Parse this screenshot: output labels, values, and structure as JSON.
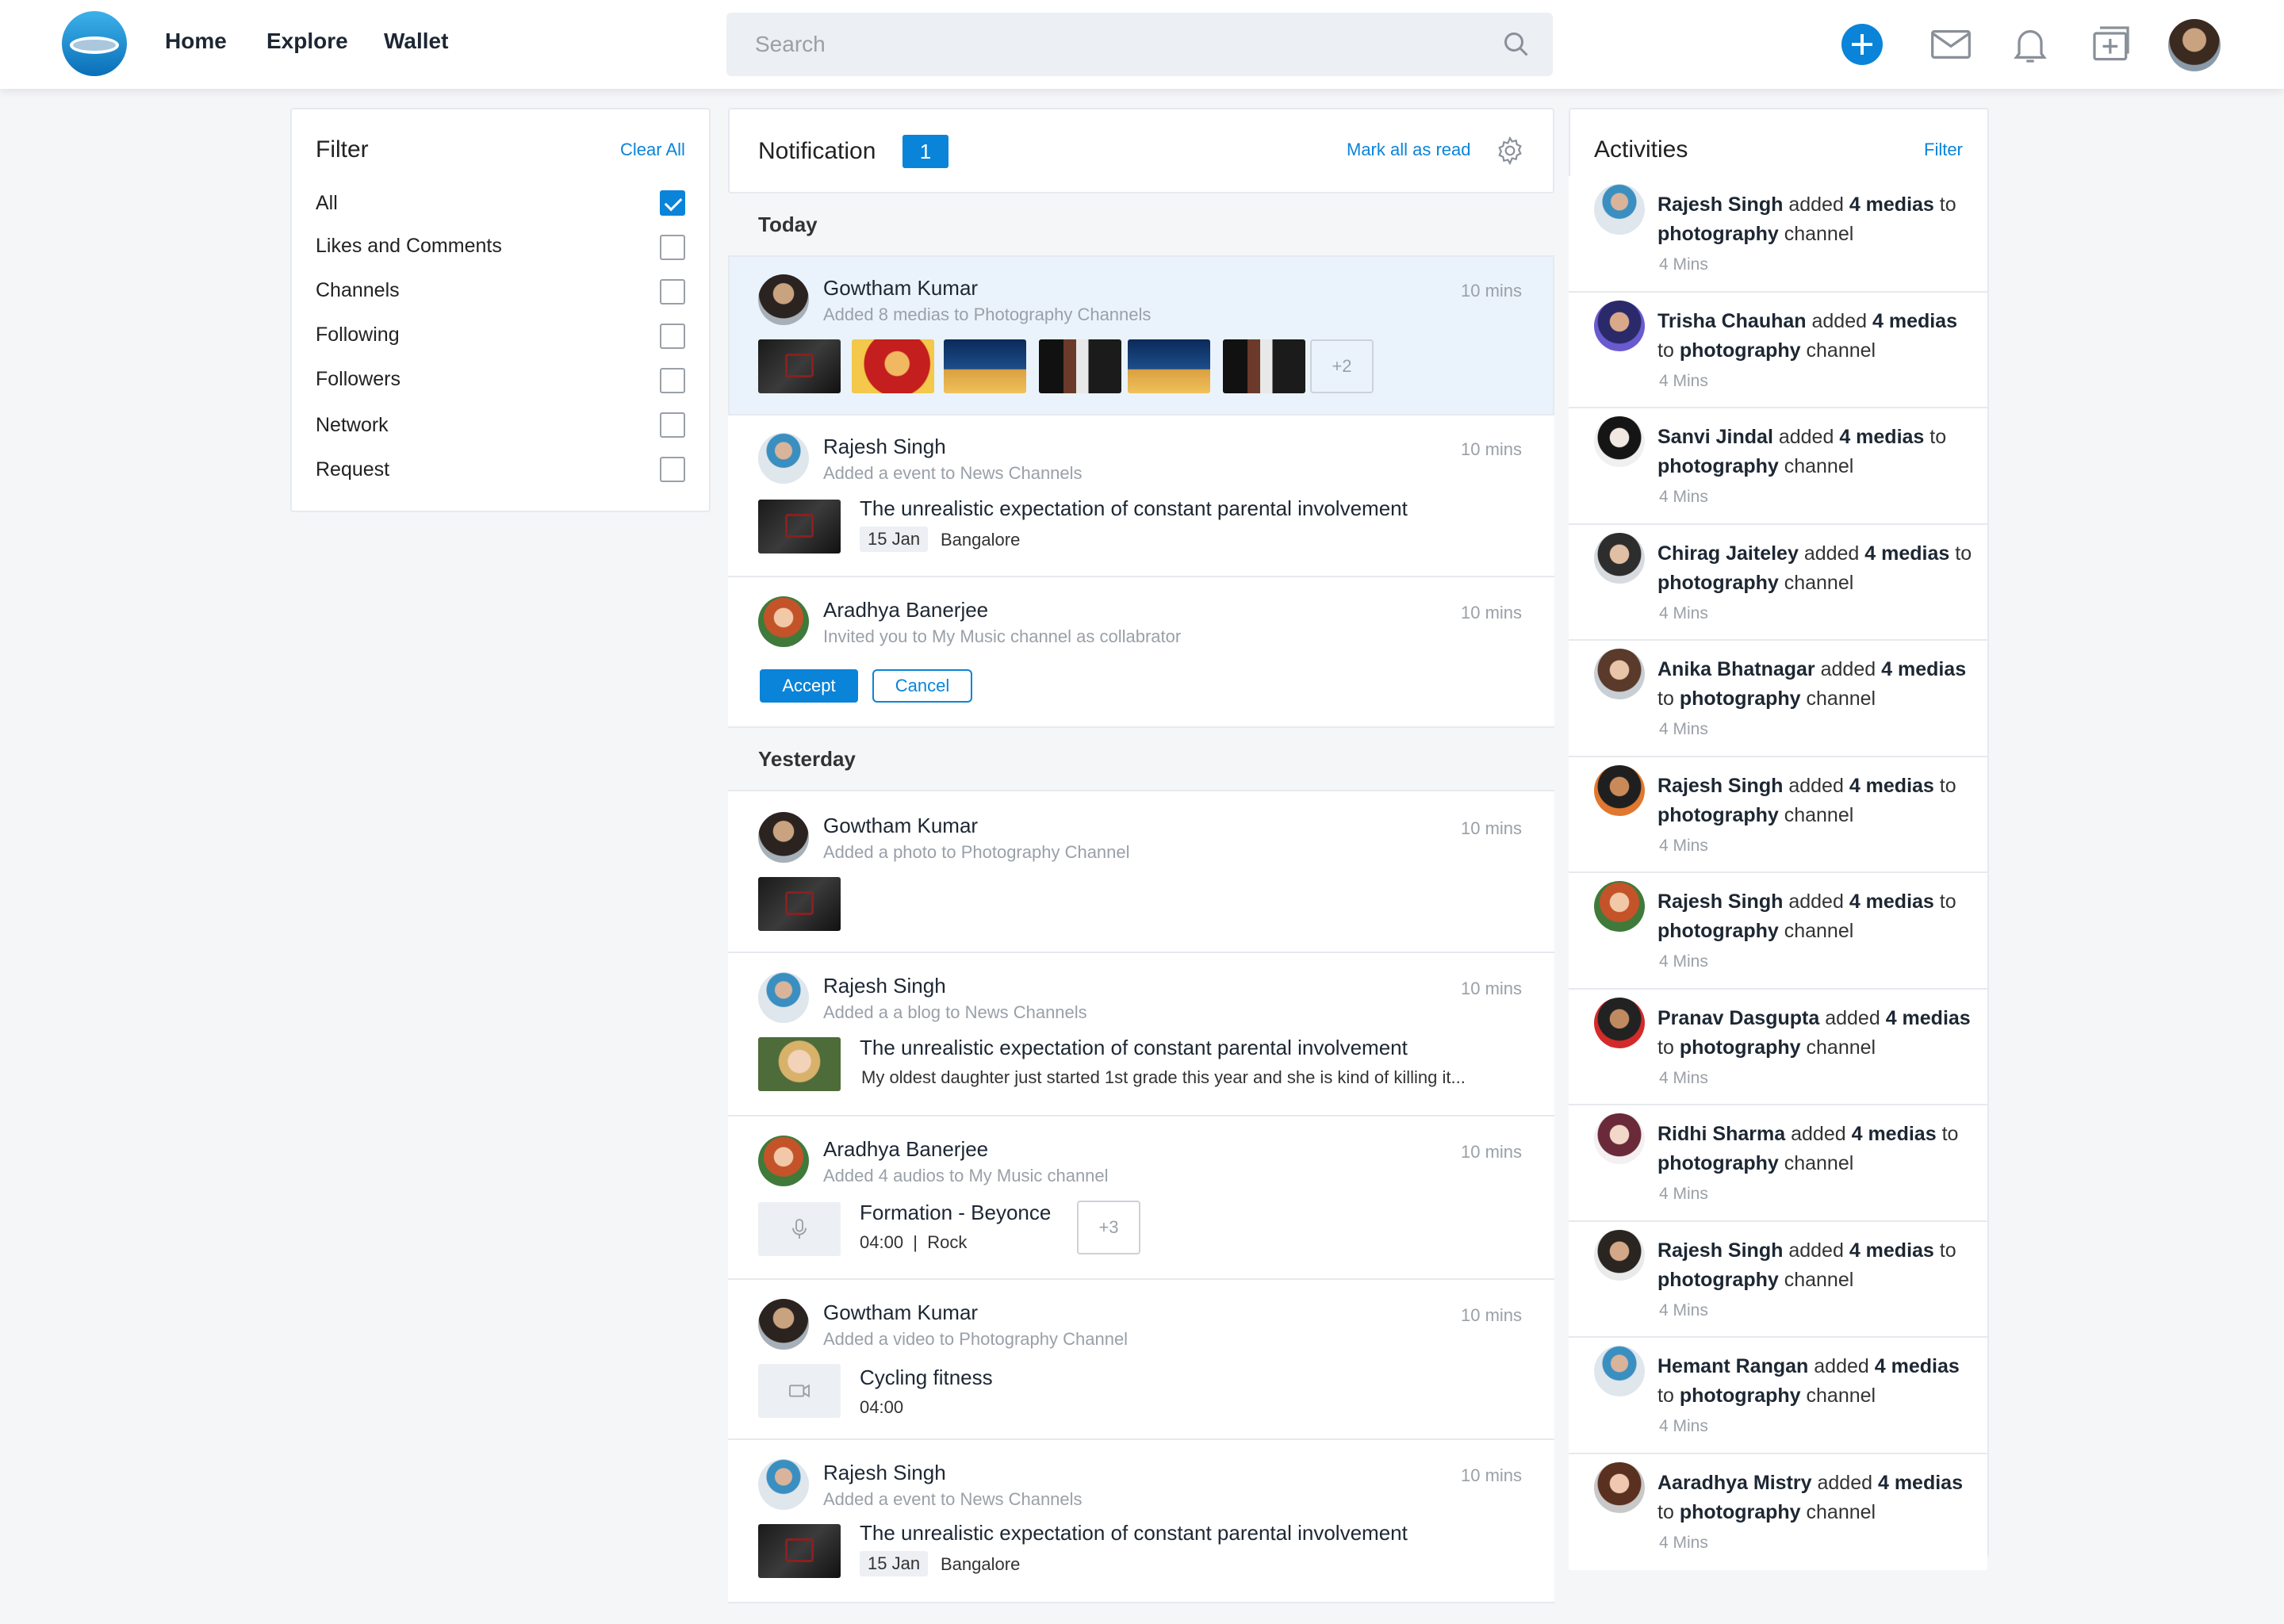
{
  "nav": {
    "home": "Home",
    "explore": "Explore",
    "wallet": "Wallet"
  },
  "search": {
    "placeholder": "Search"
  },
  "filter": {
    "title": "Filter",
    "clear": "Clear All",
    "items": [
      {
        "label": "All",
        "checked": true
      },
      {
        "label": "Likes and Comments",
        "checked": false
      },
      {
        "label": "Channels",
        "checked": false
      },
      {
        "label": "Following",
        "checked": false
      },
      {
        "label": "Followers",
        "checked": false
      },
      {
        "label": "Network",
        "checked": false
      },
      {
        "label": "Request",
        "checked": false
      }
    ]
  },
  "notification": {
    "title": "Notification",
    "count": "1",
    "mark_all": "Mark all as read",
    "today": "Today",
    "yesterday": "Yesterday",
    "items": [
      {
        "name": "Gowtham Kumar",
        "sub": "Added 8 medias to Photography Channels",
        "time": "10 mins",
        "more": "+2"
      },
      {
        "name": "Rajesh Singh",
        "sub": "Added a event to News Channels",
        "time": "10 mins",
        "title": "The unrealistic expectation of constant parental involvement",
        "date": "15 Jan",
        "place": "Bangalore"
      },
      {
        "name": "Aradhya Banerjee",
        "sub": "Invited you to My Music channel as collabrator",
        "time": "10 mins",
        "accept": "Accept",
        "cancel": "Cancel"
      },
      {
        "name": "Gowtham Kumar",
        "sub": "Added a photo to Photography Channel",
        "time": "10 mins"
      },
      {
        "name": "Rajesh Singh",
        "sub": "Added a a blog to News Channels",
        "time": "10 mins",
        "title": "The unrealistic expectation of constant parental involvement",
        "body": "My oldest daughter just started 1st grade this year and she is kind of killing it..."
      },
      {
        "name": "Aradhya Banerjee",
        "sub": "Added 4 audios to My Music channel",
        "time": "10 mins",
        "title": "Formation - Beyonce",
        "meta": "04:00  |  Rock",
        "more": "+3"
      },
      {
        "name": "Gowtham Kumar",
        "sub": "Added a video to Photography Channel",
        "time": "10 mins",
        "title": "Cycling fitness",
        "meta": "04:00"
      },
      {
        "name": "Rajesh Singh",
        "sub": "Added a event to News Channels",
        "time": "10 mins",
        "title": "The unrealistic expectation of constant parental involvement",
        "date": "15 Jan",
        "place": "Bangalore"
      }
    ]
  },
  "activities": {
    "title": "Activities",
    "filter": "Filter",
    "items": [
      {
        "name": "Rajesh Singh",
        "mid": "added",
        "count": "4 medias",
        "to": "to",
        "channel": "photography",
        "tail": "channel",
        "time": "4 Mins"
      },
      {
        "name": "Trisha Chauhan",
        "mid": "added",
        "count": "4 medias",
        "to": "to",
        "channel": "photography",
        "tail": "channel",
        "time": "4 Mins"
      },
      {
        "name": "Sanvi Jindal",
        "mid": "added",
        "count": "4 medias",
        "to": "to",
        "channel": "photography",
        "tail": "channel",
        "time": "4 Mins"
      },
      {
        "name": "Chirag Jaiteley",
        "mid": "added",
        "count": "4 medias",
        "to": "to",
        "channel": "photography",
        "tail": "channel",
        "time": "4 Mins"
      },
      {
        "name": "Anika Bhatnagar",
        "mid": "added",
        "count": "4 medias",
        "to": "to",
        "channel": "photography",
        "tail": "channel",
        "time": "4 Mins"
      },
      {
        "name": "Rajesh Singh",
        "mid": "added",
        "count": "4 medias",
        "to": "to",
        "channel": "photography",
        "tail": "channel",
        "time": "4 Mins"
      },
      {
        "name": "Rajesh Singh",
        "mid": "added",
        "count": "4 medias",
        "to": "to",
        "channel": "photography",
        "tail": "channel",
        "time": "4 Mins"
      },
      {
        "name": "Pranav Dasgupta",
        "mid": "added",
        "count": "4 medias",
        "to": "to",
        "channel": "photography",
        "tail": "channel",
        "time": "4 Mins"
      },
      {
        "name": "Ridhi Sharma",
        "mid": "added",
        "count": "4 medias",
        "to": "to",
        "channel": "photography",
        "tail": "channel",
        "time": "4 Mins"
      },
      {
        "name": "Rajesh Singh",
        "mid": "added",
        "count": "4 medias",
        "to": "to",
        "channel": "photography",
        "tail": "channel",
        "time": "4 Mins"
      },
      {
        "name": "Hemant Rangan",
        "mid": "added",
        "count": "4 medias",
        "to": "to",
        "channel": "photography",
        "tail": "channel",
        "time": "4 Mins"
      },
      {
        "name": "Aaradhya Mistry",
        "mid": "added",
        "count": "4 medias",
        "to": "to",
        "channel": "photography",
        "tail": "channel",
        "time": "4 Mins"
      }
    ]
  },
  "colors": {
    "accent": "#0a84d8",
    "highlight": "#eaf3fb",
    "background": "#f5f6f8"
  },
  "icons": [
    "logo",
    "search-icon",
    "plus-icon",
    "mail-icon",
    "bell-icon",
    "add-media-icon",
    "settings-icon",
    "mic-icon",
    "video-icon",
    "check-icon"
  ]
}
